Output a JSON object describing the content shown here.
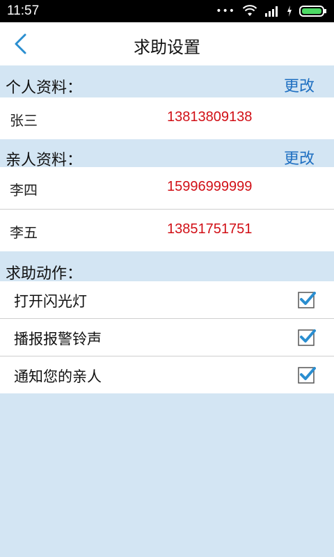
{
  "status_bar": {
    "time": "11:57"
  },
  "header": {
    "title": "求助设置"
  },
  "personal": {
    "label": "个人资料：",
    "edit_label": "更改",
    "contact": {
      "name": "张三",
      "phone": "13813809138"
    }
  },
  "relatives": {
    "label": "亲人资料：",
    "edit_label": "更改",
    "contacts": [
      {
        "name": "李四",
        "phone": "15996999999"
      },
      {
        "name": "李五",
        "phone": "13851751751"
      }
    ]
  },
  "actions": {
    "label": "求助动作：",
    "items": [
      {
        "label": "打开闪光灯",
        "checked": true
      },
      {
        "label": "播报报警铃声",
        "checked": true
      },
      {
        "label": "通知您的亲人",
        "checked": true
      }
    ]
  },
  "colors": {
    "accent": "#1e6fc1",
    "phone": "#d10f16",
    "section_bg": "#d3e5f3",
    "checkbox": "#2a8ed0"
  }
}
